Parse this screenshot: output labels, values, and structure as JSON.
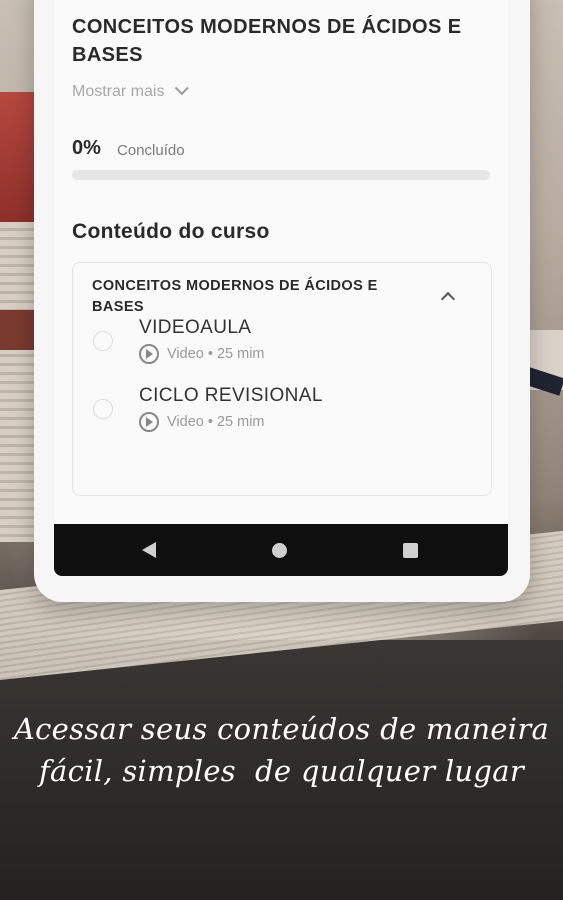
{
  "course": {
    "title": "CONCEITOS MODERNOS DE ÁCIDOS E BASES",
    "show_more": "Mostrar mais",
    "progress_value": "0%",
    "progress_label": "Concluído",
    "progress_fraction": 0
  },
  "content": {
    "heading": "Conteúdo do curso",
    "module": {
      "title": "CONCEITOS MODERNOS DE ÁCIDOS E BASES",
      "lessons": [
        {
          "name": "VIDEOAULA",
          "meta": "Video • 25 mim",
          "icon": "play-circle-icon"
        },
        {
          "name": "CICLO REVISIONAL",
          "meta": "Video • 25 mim",
          "icon": "play-circle-icon"
        }
      ]
    }
  },
  "navbar": {
    "icons": [
      "back-icon",
      "home-icon",
      "recents-icon"
    ]
  },
  "caption": {
    "line1": "Acessar seus conteúdos de maneira",
    "line2": "fácil, simples  de qualquer lugar"
  }
}
